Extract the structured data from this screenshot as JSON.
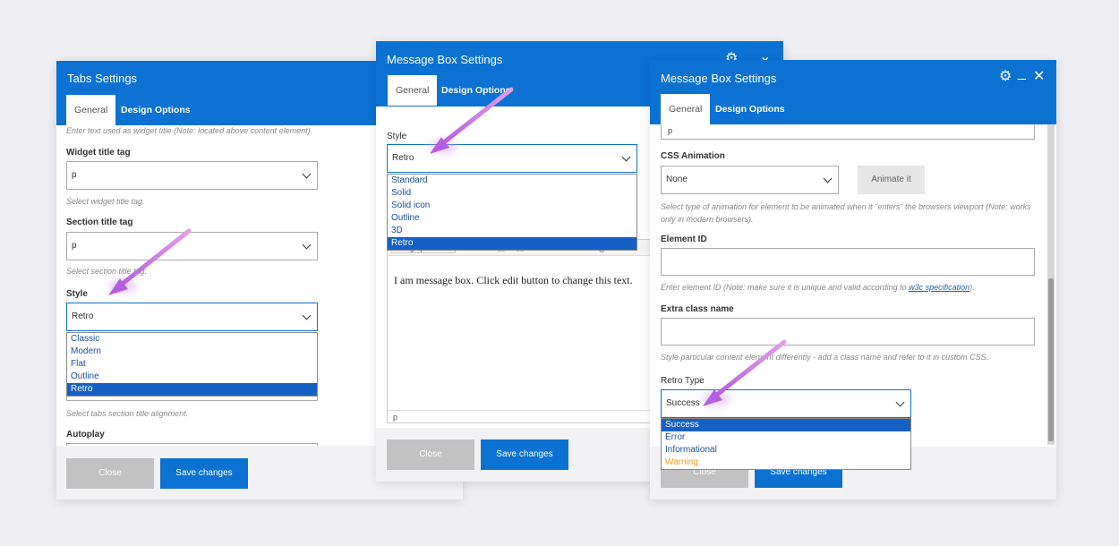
{
  "left": {
    "title": "Tabs Settings",
    "tabs": [
      "General",
      "Design Options"
    ],
    "top_hint": "Enter text used as widget title (Note: located above content element).",
    "widget_tag_label": "Widget title tag",
    "widget_tag_value": "p",
    "widget_tag_hint": "Select widget title tag.",
    "section_tag_label": "Section title tag",
    "section_tag_value": "p",
    "section_tag_hint": "Select section title tag.",
    "style_label": "Style",
    "style_value": "Retro",
    "style_options": [
      "Classic",
      "Modern",
      "Flat",
      "Outline",
      "Retro"
    ],
    "alignment_hint": "Select tabs section title alignment.",
    "autoplay_label": "Autoplay",
    "close": "Close",
    "save": "Save changes"
  },
  "middle": {
    "title": "Message Box Settings",
    "tabs": [
      "General",
      "Design Options"
    ],
    "style_label": "Style",
    "style_value": "Retro",
    "style_options": [
      "Standard",
      "Solid",
      "Solid icon",
      "Outline",
      "3D",
      "Retro"
    ],
    "format_value": "Paragraph",
    "editor_text": "I am message box. Click edit button to change this text.",
    "editor_path": "p",
    "close": "Close",
    "save": "Save changes"
  },
  "right": {
    "title": "Message Box Settings",
    "tabs": [
      "General",
      "Design Options"
    ],
    "top_text": "p",
    "css_anim_label": "CSS Animation",
    "css_anim_value": "None",
    "animate_btn": "Animate it",
    "css_anim_hint": "Select type of animation for element to be animated when it \"enters\" the browsers viewport (Note: works only in modern browsers).",
    "element_id_label": "Element ID",
    "element_id_hint_pre": "Enter element ID (Note: make sure it is unique and valid according to ",
    "element_id_hint_link": "w3c specification",
    "element_id_hint_post": ").",
    "extra_class_label": "Extra class name",
    "extra_class_hint": "Style particular content element differently - add a class name and refer to it in custom CSS.",
    "retro_type_label": "Retro Type",
    "retro_type_value": "Success",
    "retro_type_options": [
      "Success",
      "Error",
      "Informational",
      "Warning"
    ],
    "warning_color": "#f0a020",
    "close": "Close",
    "save": "Save changes"
  },
  "colors": {
    "header": "#0b72d2",
    "selected": "#1660c5",
    "arrow": "#b65fe0"
  }
}
